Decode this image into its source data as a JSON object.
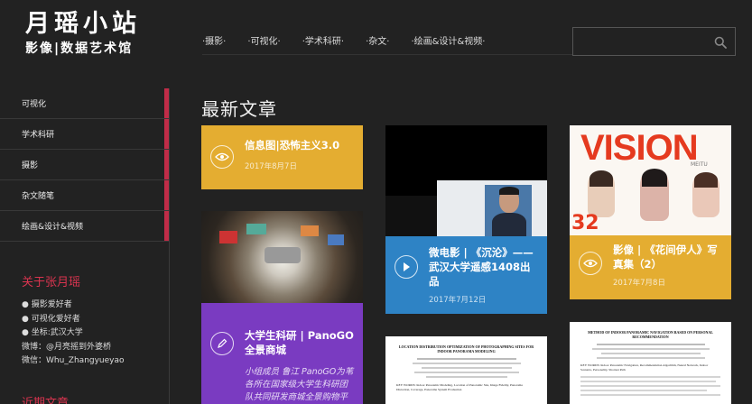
{
  "brand": {
    "title": "月瑶小站",
    "subtitle": "影像|数据艺术馆"
  },
  "nav": {
    "items": [
      {
        "label": "·摄影·"
      },
      {
        "label": "·可视化·"
      },
      {
        "label": "·学术科研·"
      },
      {
        "label": "·杂文·"
      },
      {
        "label": "·绘画&设计&视频·"
      }
    ]
  },
  "search": {
    "placeholder": ""
  },
  "sidebar": {
    "items": [
      {
        "label": "可视化"
      },
      {
        "label": "学术科研"
      },
      {
        "label": "摄影"
      },
      {
        "label": "杂文随笔"
      },
      {
        "label": "绘画&设计&视频"
      }
    ],
    "about_title": "关于张月瑶",
    "about_lines": [
      "● 摄影爱好者",
      "● 可视化爱好者",
      "● 坐标:武汉大学",
      "微博：@月亮摇到外婆桥",
      "微信：Whu_Zhangyueyao"
    ],
    "recent_title": "近期文章"
  },
  "main": {
    "title": "最新文章",
    "cards": [
      {
        "title": "信息图|恐怖主义3.0",
        "date": "2017年8月7日"
      },
      {
        "title": "微电影 | 《沉沦》——武汉大学遥感1408出品",
        "date": "2017年7月12日"
      },
      {
        "title": "影像 | 《花间伊人》写真集（2）",
        "date": "2017年7月8日",
        "image_text": "VISION",
        "image_sub": "MEITU",
        "image_num": "32"
      },
      {
        "title": "大学生科研 | PanoGO全景商城",
        "excerpt": "小组成员 鲁江 PanoGO为苇各所在国家级大学生科研团队共同研发商城全景购物平台，目前正在参加「...」"
      }
    ],
    "paper1": {
      "heading": "LOCATION DISTRIBUTION OPTIMIZATION OF PHOTOGRAPHING SITES FOR INDOOR PANORAMA MODELING",
      "keywords": "KEY WORDS: Indoor Panoramic Modeling, Location of Panoramic Site, Image Fidelity, Panorama Distortion, Coverage, Panorama System Evaluation"
    },
    "paper2": {
      "heading": "METHOD OF INDOOR PANORAMIC NAVIGATION BASED ON PERSONAL RECOMMENDATION",
      "keywords": "KEY WORDS: Indoor Panoramic Navigation, Recommendation Algorithm, Neural Network, Indoor Scenario, Personality, Shortest Path"
    }
  },
  "colors": {
    "background": "#222222",
    "accent_red": "#c02c48",
    "card_yellow": "#e4ad31",
    "card_blue": "#2e83c5",
    "card_purple": "#7a3bc1"
  }
}
